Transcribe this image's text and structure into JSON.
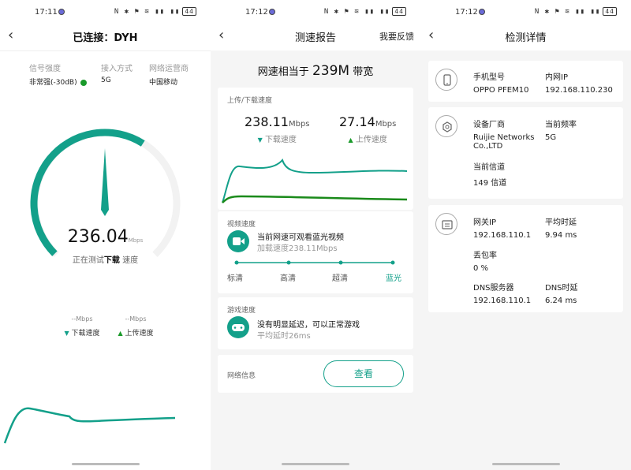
{
  "status": [
    {
      "time": "17:11",
      "battery": "44"
    },
    {
      "time": "17:12",
      "battery": "44"
    },
    {
      "time": "17:12",
      "battery": "44"
    }
  ],
  "status_icons": "N ✱ ⚑ ≋ ▮▮ ▮▮",
  "p1": {
    "title": "已连接：DYH",
    "signal_label": "信号强度",
    "signal_value": "非常强(-30dB)",
    "access_label": "接入方式",
    "access_value": "5G",
    "isp_label": "网络运营商",
    "isp_value": "中国移动",
    "speed": "236.04",
    "speed_unit": "Mbps",
    "testing_prefix": "正在测试",
    "testing_kind": "下载",
    "testing_suffix": "速度",
    "down_value": "--",
    "down_unit": "Mbps",
    "down_label": "下载速度",
    "up_value": "--",
    "up_unit": "Mbps",
    "up_label": "上传速度",
    "gauge_fraction": 0.62
  },
  "p2": {
    "title": "测速报告",
    "feedback": "我要反馈",
    "bw_prefix": "网速相当于",
    "bw_value": "239M",
    "bw_suffix": "带宽",
    "speed_card_title": "上传/下载速度",
    "down_value": "238.11",
    "down_unit": "Mbps",
    "down_label": "下载速度",
    "up_value": "27.14",
    "up_unit": "Mbps",
    "up_label": "上传速度",
    "video_title": "视频速度",
    "video_main_prefix": "当前网速可观看",
    "video_main_strong": "蓝光视频",
    "video_sub": "加载速度238.11Mbps",
    "qualities": [
      "标清",
      "高清",
      "超清",
      "蓝光"
    ],
    "game_title": "游戏速度",
    "game_main": "没有明显延迟，可以正常游戏",
    "game_sub": "平均延时26ms",
    "net_info": "网络信息",
    "view_btn": "查看"
  },
  "p3": {
    "title": "检测详情",
    "model_label": "手机型号",
    "model_value": "OPPO PFEM10",
    "lan_ip_label": "内网IP",
    "lan_ip_value": "192.168.110.230",
    "vendor_label": "设备厂商",
    "vendor_value_1": "Ruijie Networks",
    "vendor_value_2": "Co.,LTD",
    "freq_label": "当前频率",
    "freq_value": "5G",
    "channel_label": "当前信道",
    "channel_value": "149 信道",
    "gateway_label": "网关IP",
    "gateway_value": "192.168.110.1",
    "avg_delay_label": "平均时延",
    "avg_delay_value": "9.94 ms",
    "loss_label": "丢包率",
    "loss_value": "0 %",
    "dns_label": "DNS服务器",
    "dns_value": "192.168.110.1",
    "dns_delay_label": "DNS时延",
    "dns_delay_value": "6.24 ms"
  },
  "colors": {
    "accent": "#13a08a",
    "green": "#1a9a2a"
  }
}
